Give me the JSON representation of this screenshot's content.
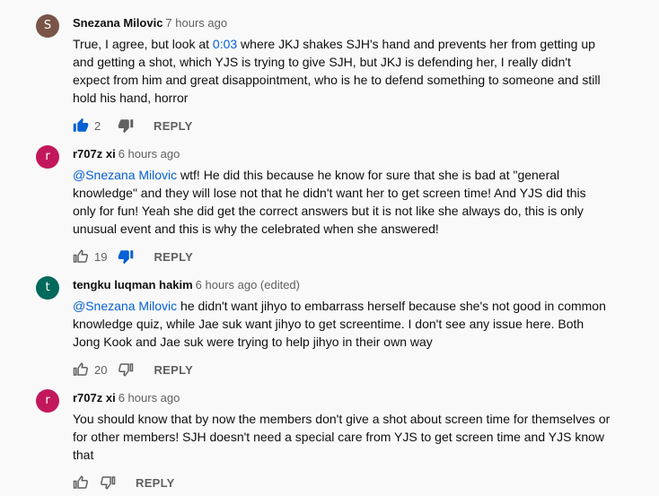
{
  "comments": [
    {
      "avatar_letter": "S",
      "avatar_color": "#795548",
      "author": "Snezana Milovic",
      "time": "7 hours ago",
      "body_link": "",
      "body_pre": "True, I agree, but look at ",
      "timestamp_link": "0:03",
      "body_post": " where JKJ shakes SJH's hand and prevents her from getting up and getting a shot, which YJS is trying to give SJH, but JKJ is defending her, I really didn't expect from him and great disappointment, who is he to defend something to someone and still hold his hand, horror",
      "likes": "2",
      "like_active": true,
      "dislike_active": false,
      "reply_label": "REPLY"
    },
    {
      "avatar_letter": "r",
      "avatar_color": "#c2185b",
      "author": "r707z xi",
      "time": "6 hours ago",
      "mention": "@Snezana Milovic",
      "body_post": " wtf! He did this because he know for sure that she is bad at \"general knowledge\" and they will lose not that he didn't want her to get screen time! And YJS did this only for fun! Yeah she did get the correct answers but it is not like she always do, this is only unusual event and this is why the celebrated when she answered!",
      "likes": "19",
      "like_active": false,
      "dislike_active": true,
      "reply_label": "REPLY"
    },
    {
      "avatar_letter": "t",
      "avatar_color": "#00695c",
      "author": "tengku luqman hakim",
      "time": "6 hours ago (edited)",
      "mention": "@Snezana Milovic",
      "body_post": " he didn't want jihyo to embarrass herself because she's not good in common knowledge quiz, while Jae suk want jihyo to get screentime. I don't see any issue here. Both Jong Kook and Jae suk were trying to help jihyo in their own way",
      "likes": "20",
      "like_active": false,
      "dislike_active": false,
      "reply_label": "REPLY"
    },
    {
      "avatar_letter": "r",
      "avatar_color": "#c2185b",
      "author": "r707z xi",
      "time": "6 hours ago",
      "body_post": "You should know that by now the members don't give a shot about screen time for themselves or for other members! SJH doesn't need a special care from YJS to get screen time and YJS know that",
      "likes": "",
      "like_active": false,
      "dislike_active": false,
      "reply_label": "REPLY"
    }
  ],
  "icons": {
    "like": "thumbs-up-icon",
    "dislike": "thumbs-down-icon"
  },
  "colors": {
    "link": "#065fd4",
    "active_icon": "#065fd4",
    "inactive_icon": "#606060"
  }
}
